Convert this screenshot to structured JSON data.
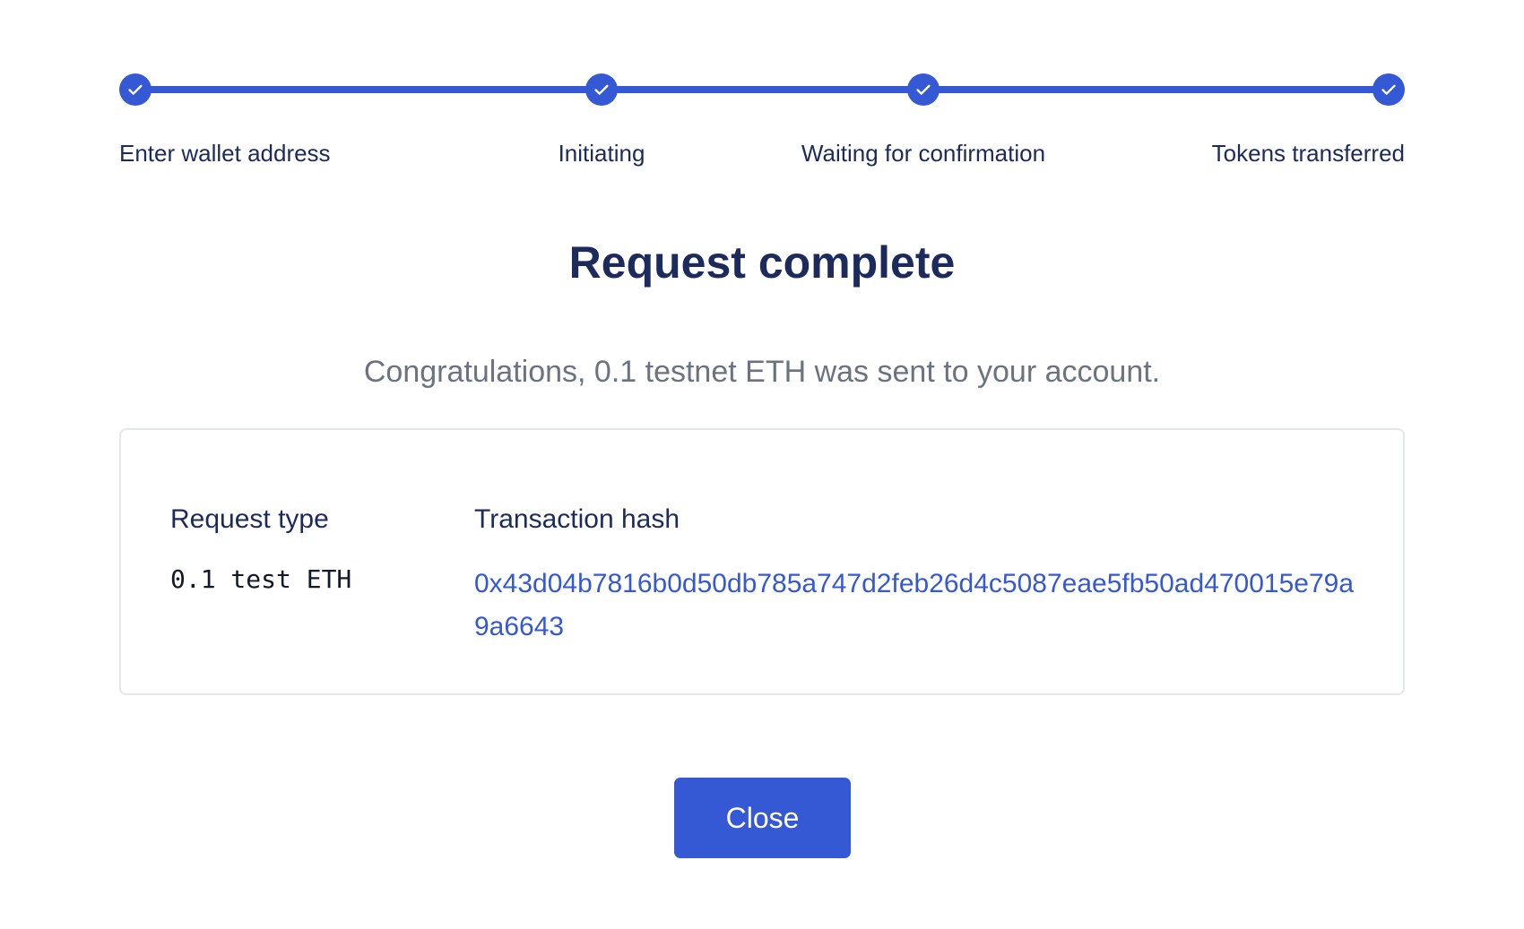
{
  "colors": {
    "accent": "#3558d4",
    "heading_text": "#1c2a5c",
    "muted_text": "#6b7280",
    "card_border": "#e3e6ea"
  },
  "stepper": {
    "steps": [
      {
        "label": "Enter wallet address",
        "icon": "check-icon",
        "completed": true
      },
      {
        "label": "Initiating",
        "icon": "check-icon",
        "completed": true
      },
      {
        "label": "Waiting for confirmation",
        "icon": "check-icon",
        "completed": true
      },
      {
        "label": "Tokens transferred",
        "icon": "check-icon",
        "completed": true
      }
    ]
  },
  "main": {
    "title": "Request complete",
    "subtitle": "Congratulations, 0.1 testnet ETH was sent to your account."
  },
  "details": {
    "request_type_header": "Request type",
    "request_type_value": "0.1 test ETH",
    "tx_hash_header": "Transaction hash",
    "tx_hash_value": "0x43d04b7816b0d50db785a747d2feb26d4c5087eae5fb50ad470015e79a9a6643"
  },
  "actions": {
    "close_label": "Close"
  }
}
